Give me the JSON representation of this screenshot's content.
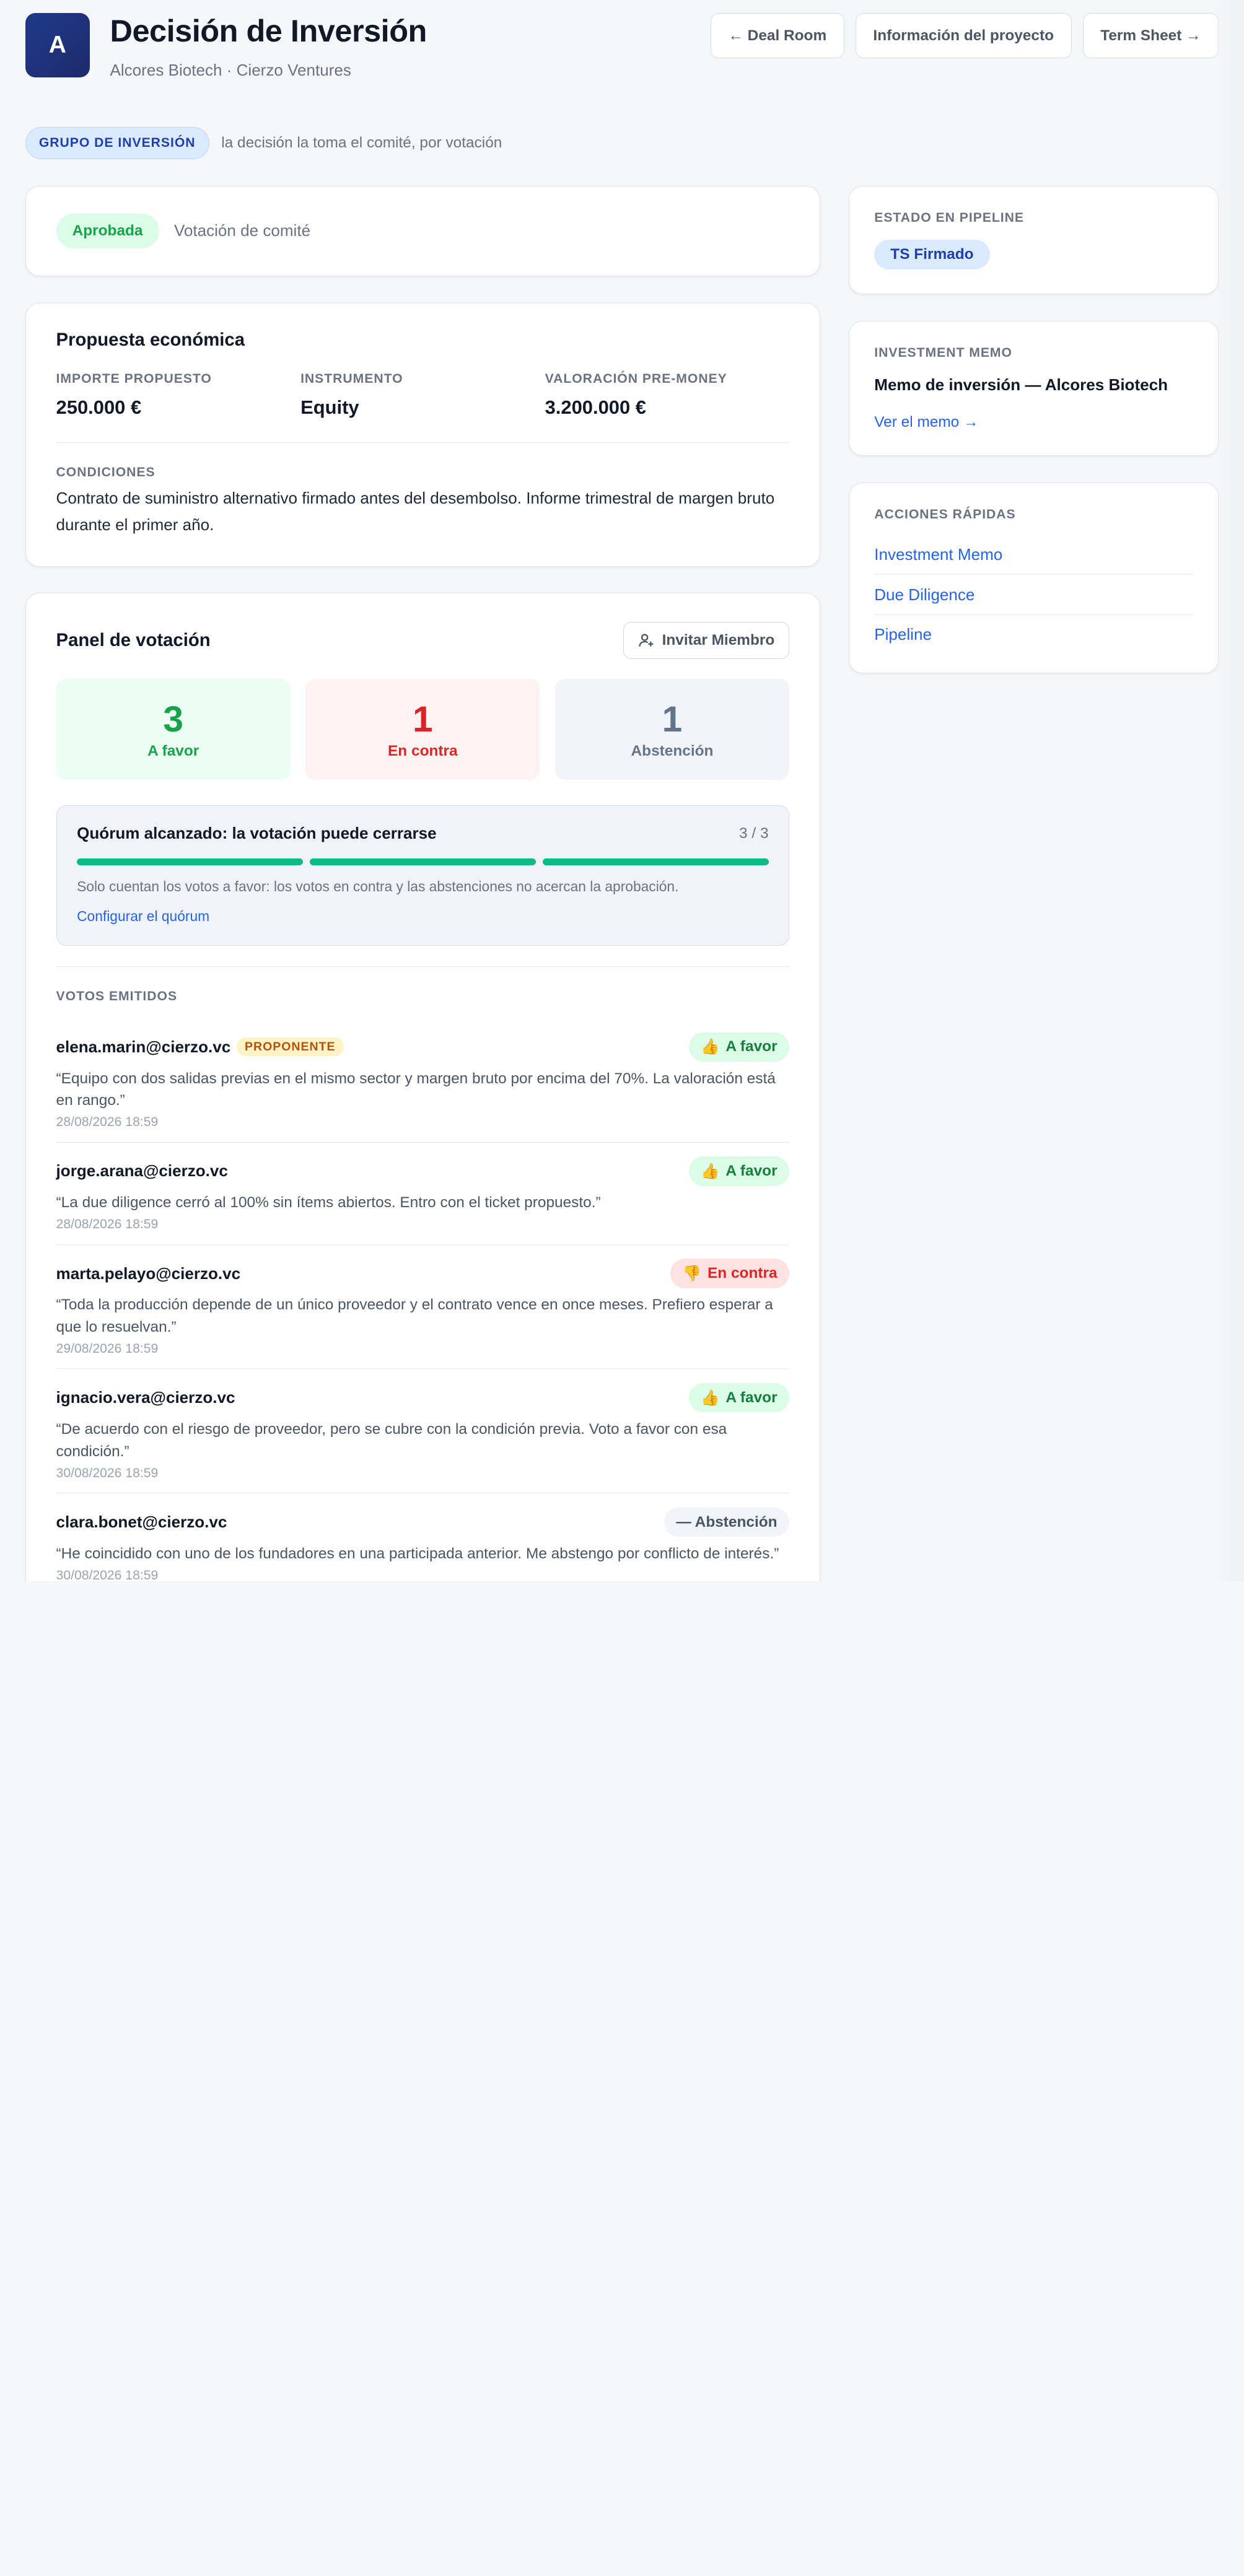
{
  "header": {
    "logo_letter": "A",
    "title": "Decisión de Inversión",
    "subtitle": "Alcores Biotech · Cierzo Ventures",
    "nav": {
      "deal_room": "← Deal Room",
      "project_info": "Información del proyecto",
      "term_sheet": "Term Sheet →"
    }
  },
  "mode": {
    "pill": "GRUPO DE INVERSIÓN",
    "text": "la decisión la toma el comité, por votación"
  },
  "status": {
    "badge": "Aprobada",
    "text": "Votación de comité"
  },
  "proposal": {
    "title": "Propuesta económica",
    "fields": [
      {
        "label": "IMPORTE PROPUESTO",
        "value": "250.000 €"
      },
      {
        "label": "INSTRUMENTO",
        "value": "Equity"
      },
      {
        "label": "VALORACIÓN PRE-MONEY",
        "value": "3.200.000 €"
      }
    ],
    "conditions_label": "CONDICIONES",
    "conditions_text": "Contrato de suministro alternativo firmado antes del desembolso. Informe trimestral de margen bruto durante el primer año."
  },
  "voting": {
    "title": "Panel de votación",
    "invite_label": "Invitar Miembro",
    "tallies": {
      "favor": "3",
      "favor_label": "A favor",
      "contra": "1",
      "contra_label": "En contra",
      "abst": "1",
      "abst_label": "Abstención"
    },
    "quorum": {
      "title": "Quórum alcanzado: la votación puede cerrarse",
      "count": "3 / 3",
      "filled": 3,
      "total": 3,
      "note": "Solo cuentan los votos a favor: los votos en contra y las abstenciones no acercan la aprobación.",
      "link": "Configurar el quórum",
      "bar_color": "#10b981"
    },
    "votes_label": "VOTOS EMITIDOS",
    "votes": [
      {
        "email": "elena.marin@cierzo.vc",
        "tag": "PROPONENTE",
        "vote": "A favor",
        "icon": "👍",
        "kind": "favor",
        "comment": "“Equipo con dos salidas previas en el mismo sector y margen bruto por encima del 70%. La valoración está en rango.”",
        "date": "28/08/2026 18:59"
      },
      {
        "email": "jorge.arana@cierzo.vc",
        "tag": "",
        "vote": "A favor",
        "icon": "👍",
        "kind": "favor",
        "comment": "“La due diligence cerró al 100% sin ítems abiertos. Entro con el ticket propuesto.”",
        "date": "28/08/2026 18:59"
      },
      {
        "email": "marta.pelayo@cierzo.vc",
        "tag": "",
        "vote": "En contra",
        "icon": "👎",
        "kind": "contra",
        "comment": "“Toda la producción depende de un único proveedor y el contrato vence en once meses. Prefiero esperar a que lo resuelvan.”",
        "date": "29/08/2026 18:59"
      },
      {
        "email": "ignacio.vera@cierzo.vc",
        "tag": "",
        "vote": "A favor",
        "icon": "👍",
        "kind": "favor",
        "comment": "“De acuerdo con el riesgo de proveedor, pero se cubre con la condición previa. Voto a favor con esa condición.”",
        "date": "30/08/2026 18:59"
      },
      {
        "email": "clara.bonet@cierzo.vc",
        "tag": "",
        "vote": "— Abstención",
        "icon": "",
        "kind": "abst",
        "comment": "“He coincidido con uno de los fundadores en una participada anterior. Me abstengo por conflicto de interés.”",
        "date": "30/08/2026 18:59"
      }
    ]
  },
  "sidebar": {
    "pipeline": {
      "label": "ESTADO EN PIPELINE",
      "value": "TS Firmado"
    },
    "memo": {
      "label": "INVESTMENT MEMO",
      "title": "Memo de inversión — Alcores Biotech",
      "link": "Ver el memo →"
    },
    "quick": {
      "label": "ACCIONES RÁPIDAS",
      "items": [
        "Investment Memo",
        "Due Diligence",
        "Pipeline"
      ]
    }
  }
}
